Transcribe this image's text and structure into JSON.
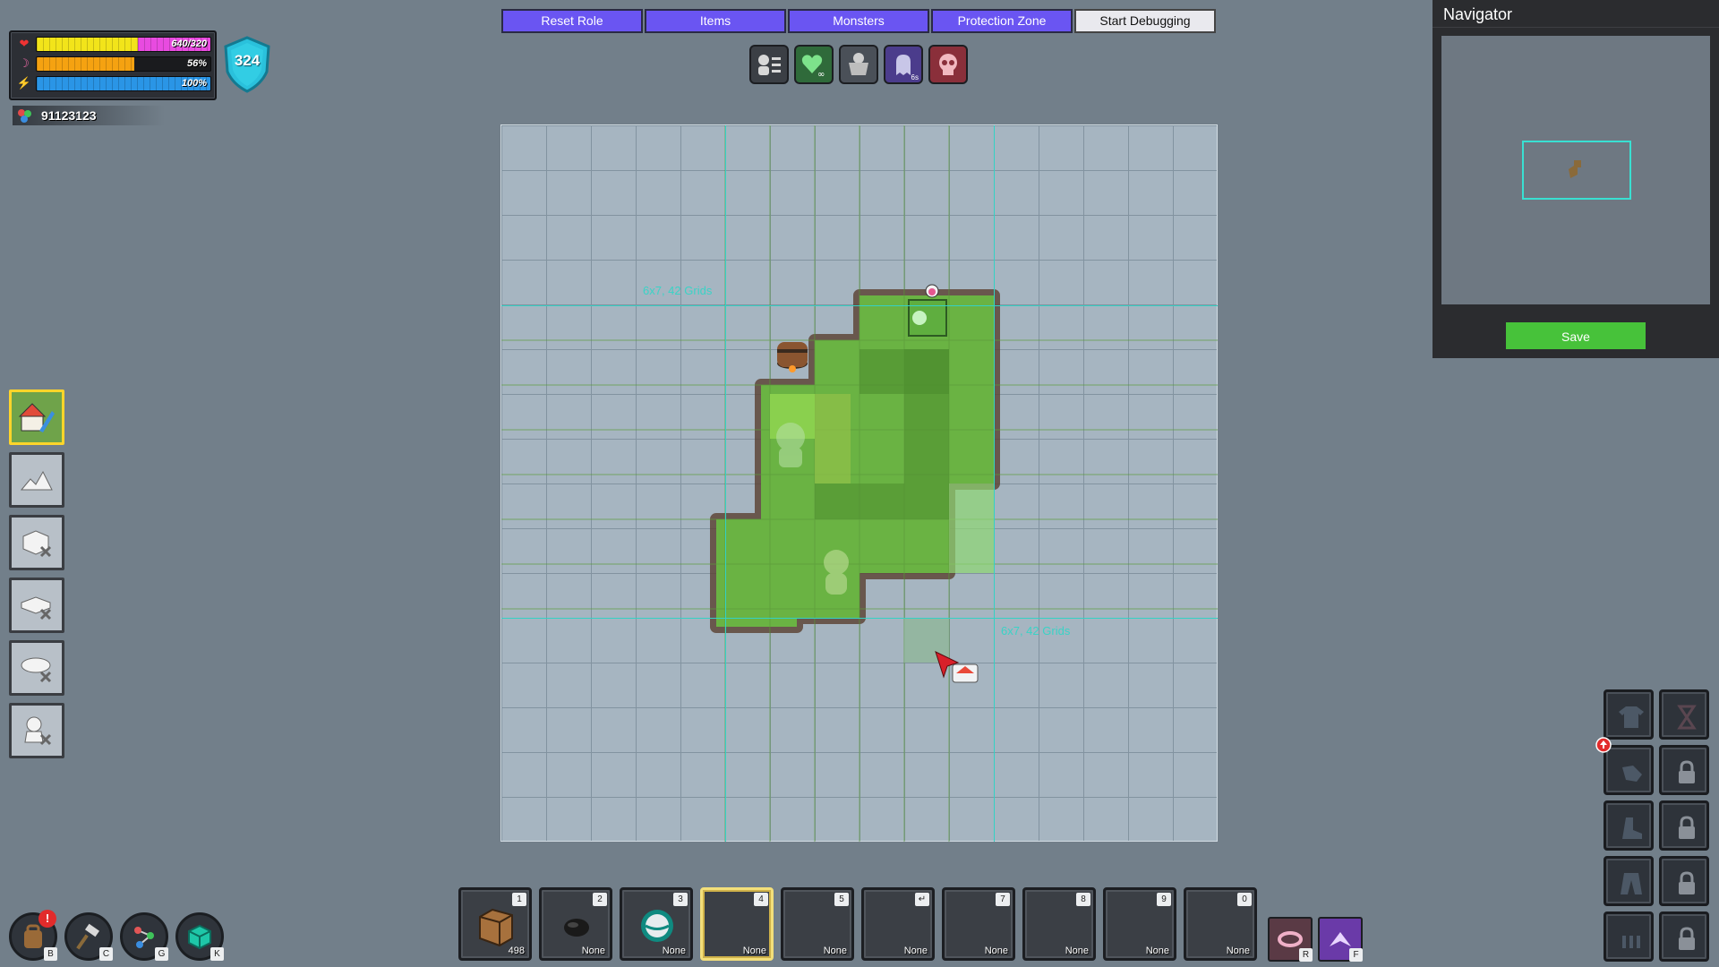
{
  "status": {
    "health_text": "640/320",
    "health_fraction": 1.0,
    "mana_text": "56%",
    "mana_fraction": 0.56,
    "energy_text": "100%",
    "energy_fraction": 1.0,
    "colors": {
      "health_yellow": "#f2e41a",
      "health_pink": "#e84be0",
      "mana": "#f5a211",
      "energy": "#2a95e6"
    }
  },
  "shield_level": "324",
  "currency": "91123123",
  "menu": {
    "reset_role": "Reset Role",
    "items": "Items",
    "monsters": "Monsters",
    "protection_zone": "Protection Zone",
    "start_debugging": "Start Debugging"
  },
  "buffs": [
    "profile-list-icon",
    "heart-infinite-icon",
    "armor-icon",
    "ghost-timer-icon",
    "skull-icon"
  ],
  "buff_timer": "6s",
  "grid": {
    "label_top": "6x7, 42 Grids",
    "label_bottom": "6x7, 42 Grids"
  },
  "tools": [
    "build-tool-icon",
    "terrain-tool-icon",
    "erase-block-icon",
    "erase-floor-icon",
    "erase-ground-icon",
    "erase-monster-icon"
  ],
  "navigator": {
    "title": "Navigator",
    "save_label": "Save"
  },
  "bottom_buttons": [
    {
      "icon": "backpack-icon",
      "key": "B",
      "alert": "!"
    },
    {
      "icon": "hammer-icon",
      "key": "C"
    },
    {
      "icon": "skill-tree-icon",
      "key": "G"
    },
    {
      "icon": "cube-icon",
      "key": "K"
    }
  ],
  "hotbar": [
    {
      "num": "1",
      "count": "498",
      "icon": "wood-block-icon"
    },
    {
      "num": "2",
      "count": "None",
      "icon": "coal-icon"
    },
    {
      "num": "3",
      "count": "None",
      "icon": "orb-icon"
    },
    {
      "num": "4",
      "count": "None",
      "icon": "empty"
    },
    {
      "num": "5",
      "count": "None",
      "icon": "empty"
    },
    {
      "num": "↵",
      "count": "None",
      "icon": "empty"
    },
    {
      "num": "7",
      "count": "None",
      "icon": "empty"
    },
    {
      "num": "8",
      "count": "None",
      "icon": "empty"
    },
    {
      "num": "9",
      "count": "None",
      "icon": "empty"
    },
    {
      "num": "0",
      "count": "None",
      "icon": "empty"
    }
  ],
  "skills": [
    {
      "key": "R",
      "icon": "whirl-skill-icon"
    },
    {
      "key": "F",
      "icon": "slash-skill-icon"
    }
  ],
  "equipment": [
    "shirt-slot-icon",
    "hourglass-slot-icon",
    "glove-slot-icon",
    "lock-icon",
    "boot-slot-icon",
    "lock-icon",
    "pants-slot-icon",
    "lock-icon",
    "belt-slot-icon",
    "lock-icon"
  ]
}
